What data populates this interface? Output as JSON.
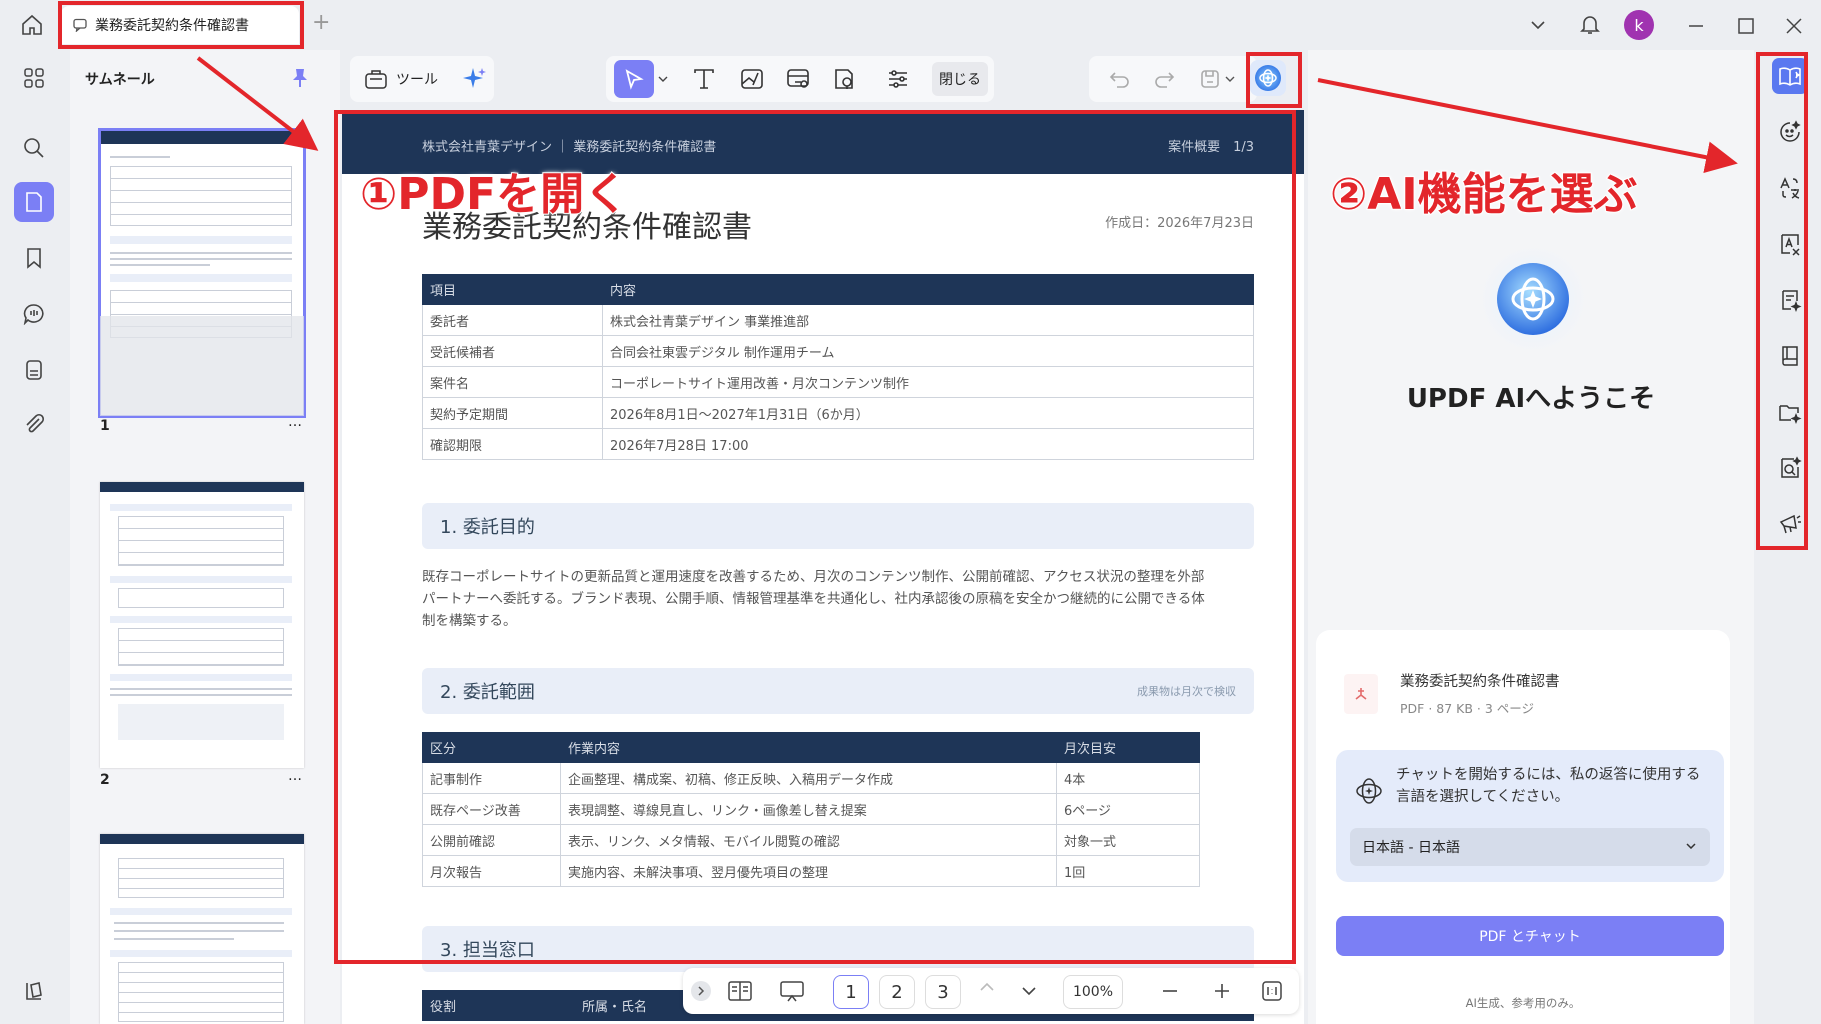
{
  "tab": {
    "title": "業務委託契約条件確認書",
    "new_tab": "+"
  },
  "user": {
    "initial": "k",
    "avatar_color": "#a033b0"
  },
  "thumbnails": {
    "title": "サムネール",
    "pages": [
      {
        "num": "1",
        "more": "…"
      },
      {
        "num": "2",
        "more": "…"
      }
    ]
  },
  "toolbar": {
    "tools_label": "ツール",
    "close_label": "閉じる"
  },
  "document": {
    "header_left": "株式会社青葉デザイン ｜ 業務委託契約条件確認書",
    "header_right": "案件概要　1/3",
    "title": "業務委託契約条件確認書",
    "date": "作成日：2026年7月23日",
    "info_table": {
      "headers": [
        "項目",
        "内容"
      ],
      "rows": [
        [
          "委託者",
          "株式会社青葉デザイン 事業推進部"
        ],
        [
          "受託候補者",
          "合同会社東雲デジタル 制作運用チーム"
        ],
        [
          "案件名",
          "コーポレートサイト運用改善・月次コンテンツ制作"
        ],
        [
          "契約予定期間",
          "2026年8月1日〜2027年1月31日（6か月）"
        ],
        [
          "確認期限",
          "2026年7月28日 17:00"
        ]
      ]
    },
    "section1": {
      "title": "1. 委託目的",
      "body": [
        "既存コーポレートサイトの更新品質と運用速度を改善するため、月次のコンテンツ制作、公開前確認、アクセス状況の整理を外部",
        "パートナーへ委託する。ブランド表現、公開手順、情報管理基準を共通化し、社内承認後の原稿を安全かつ継続的に公開できる体",
        "制を構築する。"
      ]
    },
    "section2": {
      "title": "2. 委託範囲",
      "note": "成果物は月次で検収",
      "table": {
        "headers": [
          "区分",
          "作業内容",
          "月次目安"
        ],
        "rows": [
          [
            "記事制作",
            "企画整理、構成案、初稿、修正反映、入稿用データ作成",
            "4本"
          ],
          [
            "既存ページ改善",
            "表現調整、導線見直し、リンク・画像差し替え提案",
            "6ページ"
          ],
          [
            "公開前確認",
            "表示、リンク、メタ情報、モバイル閲覧の確認",
            "対象一式"
          ],
          [
            "月次報告",
            "実施内容、未解決事項、翌月優先項目の整理",
            "1回"
          ]
        ]
      }
    },
    "section3": {
      "title": "3. 担当窓口",
      "headers": [
        "役割",
        "所属・氏名"
      ]
    }
  },
  "callouts": {
    "step1": "①PDFを開く",
    "step2": "②AI機能を選ぶ"
  },
  "ai": {
    "welcome": "UPDF AIへようこそ",
    "file_name": "業務委託契約条件確認書",
    "file_meta": "PDF · 87 KB · 3 ページ",
    "prompt": [
      "チャットを開始するには、私の返答に使用する",
      "言語を選択してください。"
    ],
    "language": "日本語 - 日本語",
    "chat_button": "PDF とチャット",
    "disclaimer": "AI生成、参考用のみ。"
  },
  "pagination": {
    "pages": [
      "1",
      "2",
      "3"
    ],
    "current": "1",
    "zoom": "100%"
  },
  "colors": {
    "accent": "#7b7ff5",
    "doc_navy": "#1e3557",
    "annotation_red": "#e3262b"
  }
}
